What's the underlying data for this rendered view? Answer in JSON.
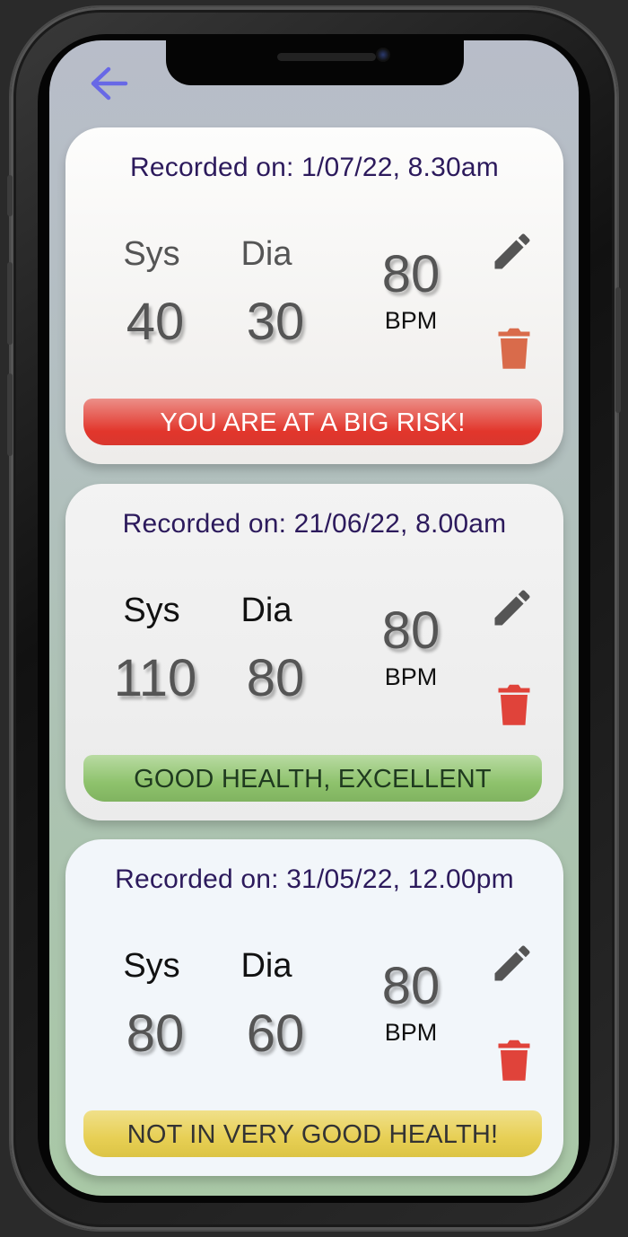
{
  "colors": {
    "accent": "#6868e6",
    "recorded_text": "#2c1a5c",
    "risk_red": "#e2362c",
    "good_green": "#8ec26c",
    "warn_yellow": "#e7cf54",
    "delete_icon_orange": "#d96b4b",
    "delete_icon_red": "#e0433a",
    "edit_icon": "#555555"
  },
  "header": {
    "back_icon": "arrow-left-icon"
  },
  "readings": [
    {
      "recorded": "Recorded on: 1/07/22, 8.30am",
      "sys_label": "Sys",
      "dia_label": "Dia",
      "sys_value": "40",
      "dia_value": "30",
      "bpm_value": "80",
      "bpm_label": "BPM",
      "status": "YOU ARE AT A BIG RISK!",
      "status_level": "risk",
      "label_color": "#555555"
    },
    {
      "recorded": "Recorded on: 21/06/22, 8.00am",
      "sys_label": "Sys",
      "dia_label": "Dia",
      "sys_value": "110",
      "dia_value": "80",
      "bpm_value": "80",
      "bpm_label": "BPM",
      "status": "GOOD HEALTH, EXCELLENT",
      "status_level": "good",
      "label_color": "#111111"
    },
    {
      "recorded": "Recorded on: 31/05/22, 12.00pm",
      "sys_label": "Sys",
      "dia_label": "Dia",
      "sys_value": "80",
      "dia_value": "60",
      "bpm_value": "80",
      "bpm_label": "BPM",
      "status": "NOT IN VERY GOOD HEALTH!",
      "status_level": "warning",
      "label_color": "#111111"
    }
  ]
}
